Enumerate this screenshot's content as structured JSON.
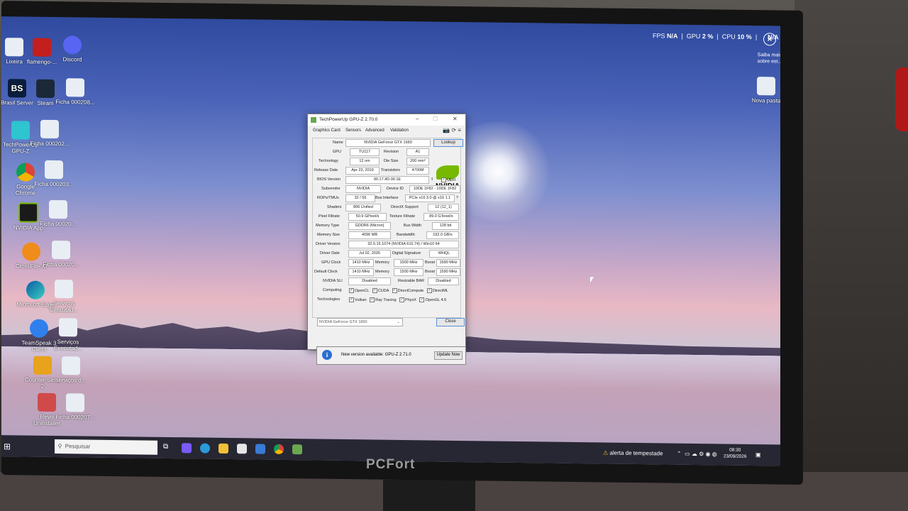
{
  "monitor_brand": "PCFort",
  "overlay": {
    "fps_label": "FPS",
    "fps_value": "N/A",
    "gpu_label": "GPU",
    "gpu_value": "2 %",
    "cpu_label": "CPU",
    "cpu_value": "10 %",
    "extra_value": "N/A",
    "saiba": "Saiba mais sobre est..."
  },
  "desktop_icons": [
    {
      "label": "Lixeira"
    },
    {
      "label": "flamengo-..."
    },
    {
      "label": "Discord"
    },
    {
      "label": "Brasil Server"
    },
    {
      "label": "Steam"
    },
    {
      "label": "Ficha 000208..."
    },
    {
      "label": "TechPowerUp GPU-Z"
    },
    {
      "label": "Ficha 000202..."
    },
    {
      "label": "Google Chrome"
    },
    {
      "label": "Ficha 000203..."
    },
    {
      "label": "NVIDIA App"
    },
    {
      "label": "Ficha 00020..."
    },
    {
      "label": "CrossFire XI"
    },
    {
      "label": "Ficha 00020..."
    },
    {
      "label": "Microsoft Edge"
    },
    {
      "label": "Serviços Executad..."
    },
    {
      "label": "TeamSpeak 3 Client"
    },
    {
      "label": "Serviços Executad..."
    },
    {
      "label": "Counter-Stri... 2"
    },
    {
      "label": "serviços d..."
    },
    {
      "label": "Revo Uninstaller"
    },
    {
      "label": "Ficha 000207..."
    },
    {
      "label": "Nova pasta"
    }
  ],
  "gpuz": {
    "title": "TechPowerUp GPU-Z 2.70.0",
    "tabs": [
      "Graphics Card",
      "Sensors",
      "Advanced",
      "Validation"
    ],
    "lookup": "Lookup",
    "vendor_logo": "NVIDIA",
    "fields": {
      "name_l": "Name",
      "name": "NVIDIA GeForce GTX 1650",
      "gpu_l": "GPU",
      "gpu": "TU117",
      "revision_l": "Revision",
      "revision": "A1",
      "tech_l": "Technology",
      "tech": "12 nm",
      "die_l": "Die Size",
      "die": "200 mm²",
      "release_l": "Release Date",
      "release": "Apr 23, 2019",
      "trans_l": "Transistors",
      "trans": "4700M",
      "bios_l": "BIOS Version",
      "bios": "90.17.4D.00.1E",
      "uefi": "UEFI",
      "subv_l": "Subvendor",
      "subv": "NVIDIA",
      "devid_l": "Device ID",
      "devid": "10DE 1F82 - 10DE 1F82",
      "rops_l": "ROPs/TMUs",
      "rops": "32 / 56",
      "bus_l": "Bus Interface",
      "bus": "PCIe x16 3.0 @ x16 1.1",
      "q": "?",
      "shaders_l": "Shaders",
      "shaders": "896 Unified",
      "dx_l": "DirectX Support",
      "dx": "12 (12_1)",
      "pix_l": "Pixel Fillrate",
      "pix": "50.9 GPixel/s",
      "tex_l": "Texture Fillrate",
      "tex": "89.0 GTexel/s",
      "memtype_l": "Memory Type",
      "memtype": "GDDR6 (Micron)",
      "bw_l": "Bus Width",
      "bw": "128 bit",
      "memsize_l": "Memory Size",
      "memsize": "4096 MB",
      "band_l": "Bandwidth",
      "band": "192.0 GB/s",
      "drv_l": "Driver Version",
      "drv": "32.0.15.1074 (NVIDIA 610.74) / Win10 64",
      "drvdate_l": "Driver Date",
      "drvdate": "Jul 02, 2026",
      "sig_l": "Digital Signature",
      "sig": "WHQL",
      "gclk_l": "GPU Clock",
      "gclk": "1410 MHz",
      "mem_l": "Memory",
      "gmem": "1500 MHz",
      "boost_l": "Boost",
      "gboost": "1590 MHz",
      "dclk_l": "Default Clock",
      "dclk": "1410 MHz",
      "dmem": "1500 MHz",
      "dboost": "1590 MHz",
      "sli_l": "NVIDIA SLI",
      "sli": "Disabled",
      "rbar_l": "Resizable BAR",
      "rbar": "Disabled",
      "comp_l": "Computing",
      "tech2_l": "Technologies"
    },
    "computing": [
      "OpenCL",
      "CUDA",
      "DirectCompute",
      "DirectML"
    ],
    "technologies": [
      "Vulkan",
      "Ray Tracing",
      "PhysX",
      "OpenGL 4.6"
    ],
    "selected_gpu": "NVIDIA GeForce GTX 1650",
    "close": "Close",
    "update_msg": "New version available: GPU-Z 2.71.0",
    "update_btn": "Update Now"
  },
  "taskbar": {
    "search_placeholder": "Pesquisar",
    "weather": "alerta de tempestade",
    "time": "08:30",
    "date": "23/09/2026"
  }
}
